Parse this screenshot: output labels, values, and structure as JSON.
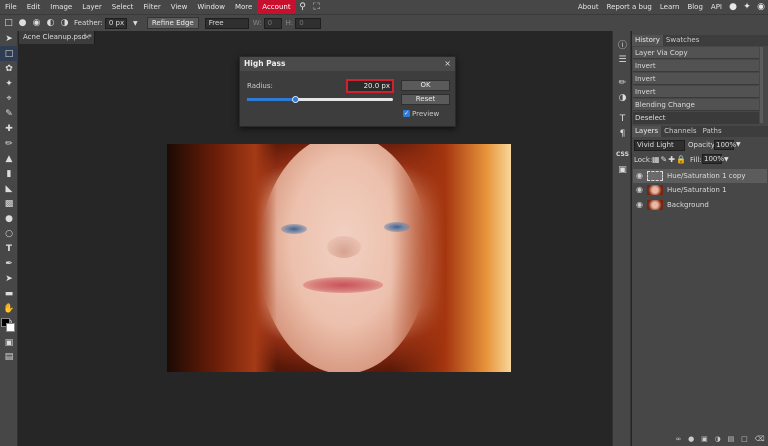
{
  "menubar": {
    "items": [
      "File",
      "Edit",
      "Image",
      "Layer",
      "Select",
      "Filter",
      "View",
      "Window",
      "More",
      "Account"
    ],
    "right_items": [
      "About",
      "Report a bug",
      "Learn",
      "Blog",
      "API"
    ]
  },
  "options": {
    "feather_label": "Feather:",
    "feather_value": "0 px",
    "refine_label": "Refine Edge",
    "style_value": "Free",
    "w_label": "W:",
    "w_value": "0",
    "h_label": "H:",
    "h_value": "0"
  },
  "document": {
    "tab_title": "Acne Cleanup.psd *",
    "tab_close": "×"
  },
  "dialog": {
    "title": "High Pass",
    "close": "×",
    "radius_label": "Radius:",
    "radius_value": "20.0 px",
    "slider_fraction": 0.33,
    "ok_label": "OK",
    "reset_label": "Reset",
    "preview_label": "Preview",
    "preview_checked": true
  },
  "history": {
    "tabs": [
      "History",
      "Swatches"
    ],
    "items": [
      "Layer Via Copy",
      "Invert",
      "Invert",
      "Invert",
      "Blending Change",
      "Deselect"
    ]
  },
  "layers": {
    "tabs": [
      "Layers",
      "Channels",
      "Paths"
    ],
    "blend_mode": "Vivid Light",
    "opacity_label": "Opacity:",
    "opacity_value": "100%",
    "lock_label": "Lock:",
    "fill_label": "Fill:",
    "fill_value": "100%",
    "rows": [
      {
        "name": "Hue/Saturation 1 copy",
        "selected": true
      },
      {
        "name": "Hue/Saturation 1",
        "selected": false
      },
      {
        "name": "Background",
        "selected": false
      }
    ]
  },
  "iconcol": {
    "css_label": "CSS"
  },
  "colors": {
    "accent": "#c8102e",
    "highlight_blue": "#2e7bd6",
    "panel_bg": "#474747",
    "workspace_bg": "#262626"
  }
}
